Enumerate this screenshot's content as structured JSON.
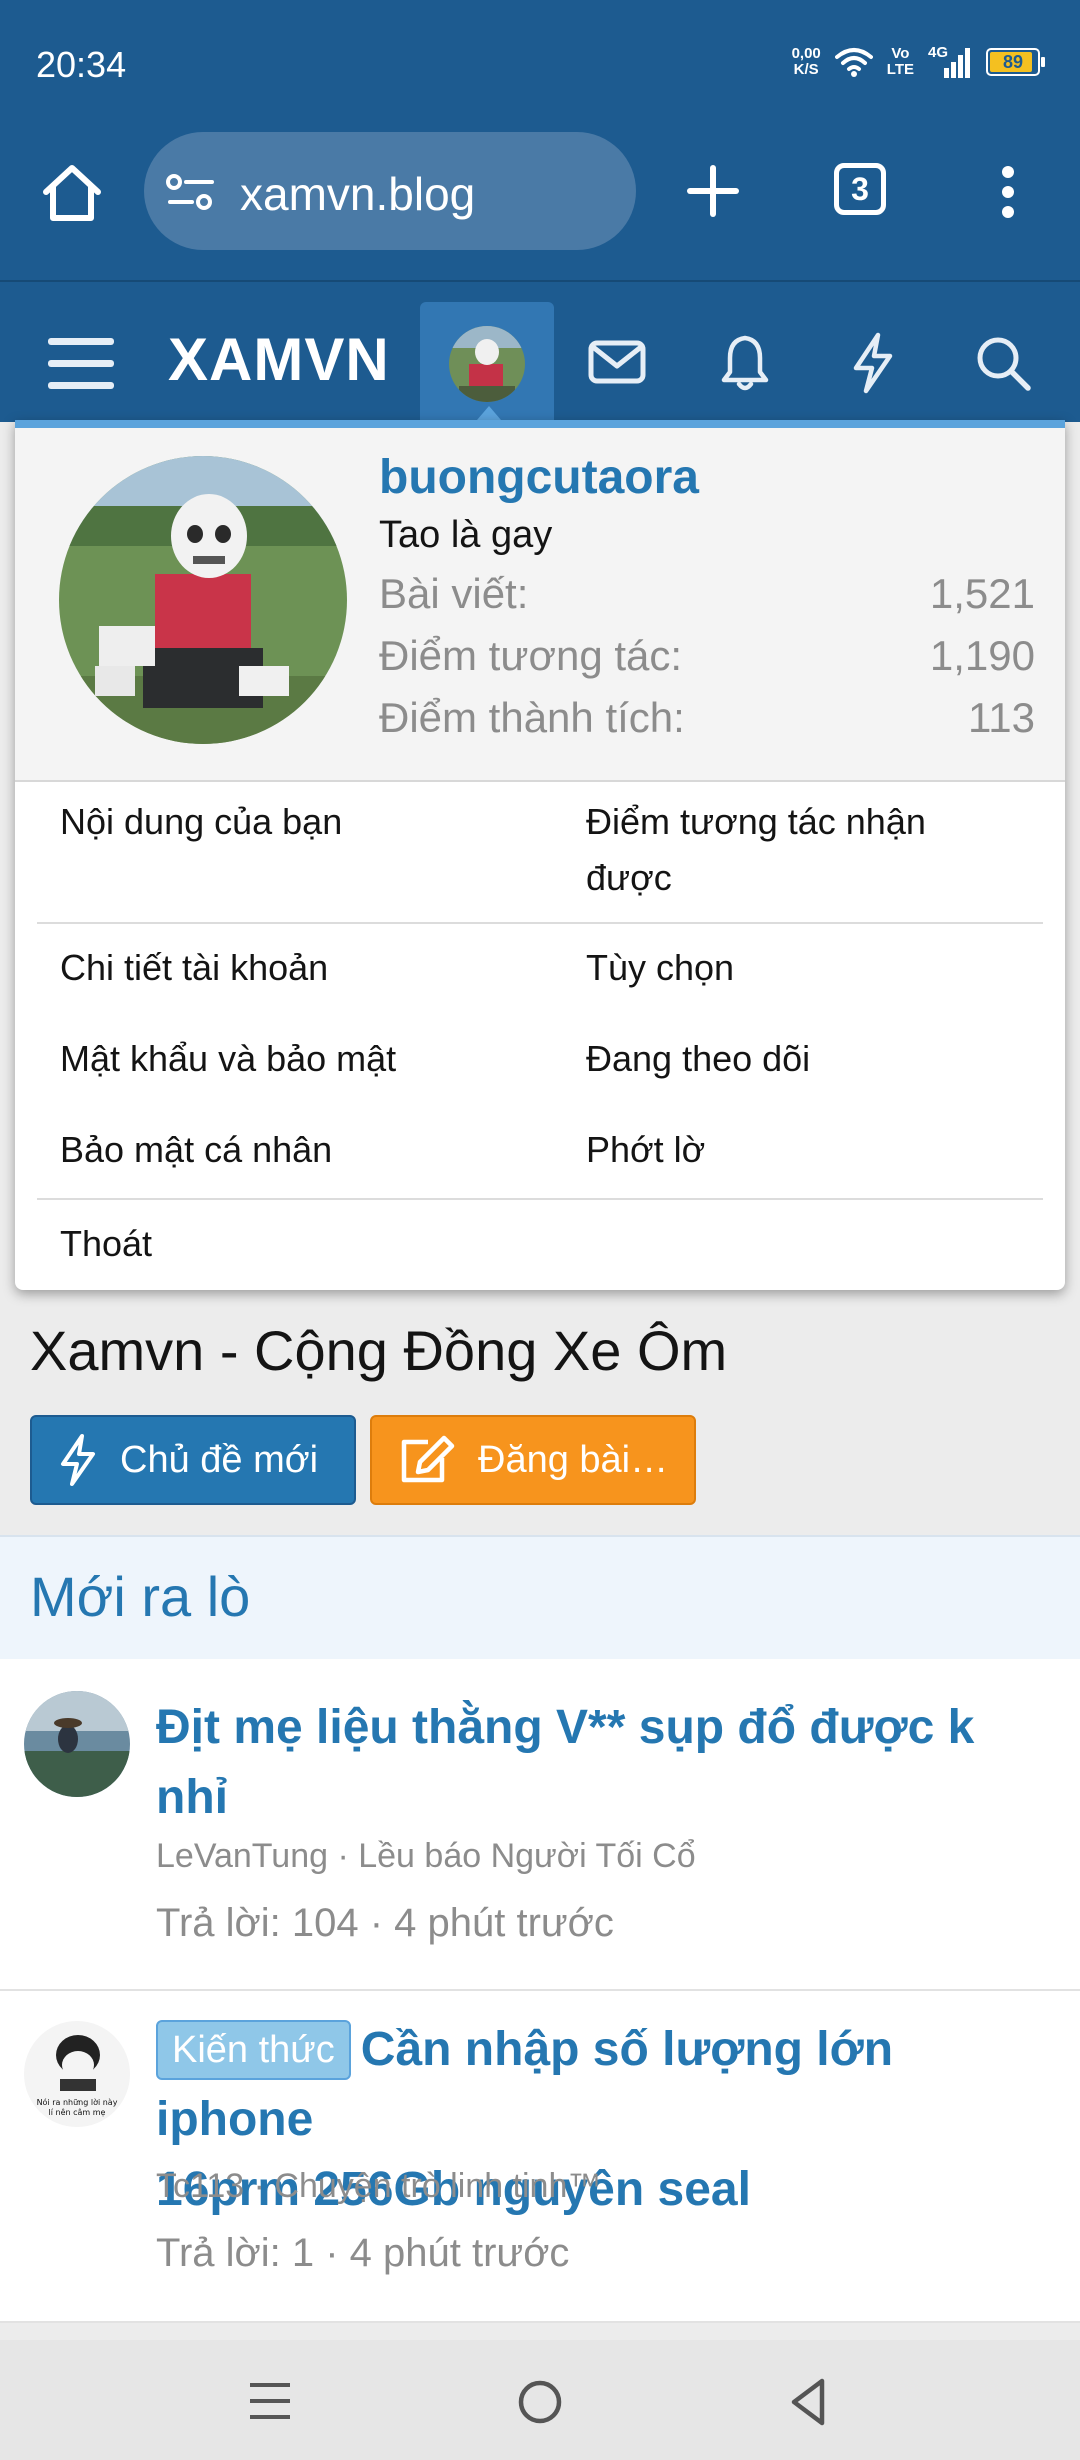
{
  "status_bar": {
    "time": "20:34",
    "net_speed_value": "0,00",
    "net_speed_unit": "K/S",
    "volte_top": "Vo",
    "volte_bottom": "LTE",
    "network": "4G",
    "battery": "89",
    "icons": [
      "wifi-icon",
      "signal-icon",
      "battery-icon"
    ]
  },
  "browser": {
    "url": "xamvn.blog",
    "tab_count": "3",
    "icons": [
      "home-icon",
      "site-settings-icon",
      "new-tab-icon",
      "tabs-icon",
      "more-menu-icon"
    ]
  },
  "site_header": {
    "logo": "XAMVN",
    "icons": [
      "hamburger-menu-icon",
      "mail-icon",
      "bell-icon",
      "lightning-icon",
      "search-icon"
    ]
  },
  "account_menu": {
    "username": "buongcutaora",
    "user_title": "Tao là gay",
    "stats": [
      {
        "label": "Bài viết:",
        "value": "1,521"
      },
      {
        "label": "Điểm tương tác:",
        "value": "1,190"
      },
      {
        "label": "Điểm thành tích:",
        "value": "113"
      }
    ],
    "links_top": {
      "left": "Nội dung của bạn",
      "right_line1": "Điểm tương tác nhận",
      "right_line2": "được"
    },
    "links": [
      {
        "left": "Chi tiết tài khoản",
        "right": "Tùy chọn"
      },
      {
        "left": "Mật khẩu và bảo mật",
        "right": "Đang theo dõi"
      },
      {
        "left": "Bảo mật cá nhân",
        "right": "Phớt lờ"
      }
    ],
    "logout": "Thoát"
  },
  "page": {
    "title": "Xamvn - Cộng Đồng Xe Ôm",
    "new_thread_button": "Chủ đề mới",
    "post_button": "Đăng bài…",
    "section_title": "Mới ra lò"
  },
  "threads": [
    {
      "prefix": "",
      "title_line1": "Địt mẹ liệu thằng V** sụp đổ được k",
      "title_line2": "nhỉ",
      "meta": "LeVanTung · Lều báo Người Tối Cổ",
      "stats": "Trả lời: 104 · 4 phút trước"
    },
    {
      "prefix": "Kiến thức",
      "title_line1": "Cần nhập số lượng lớn iphone",
      "title_line2": "16prm 256Gb nguyên seal",
      "meta": "Tc113 · Chuyện trò linh tinh™",
      "stats": "Trả lời: 1 · 4 phút trước",
      "avatar_text_1": "Nói ra những lời này",
      "avatar_text_2": "lí nên câm mẹ"
    }
  ],
  "nav_bar": {
    "icons": [
      "recents-icon",
      "home-circle-icon",
      "back-icon"
    ]
  },
  "colors": {
    "header_blue": "#1d5b90",
    "link_blue": "#2577b1",
    "accent_orange": "#f7941d",
    "highlight_blue": "#5ba3dc"
  }
}
